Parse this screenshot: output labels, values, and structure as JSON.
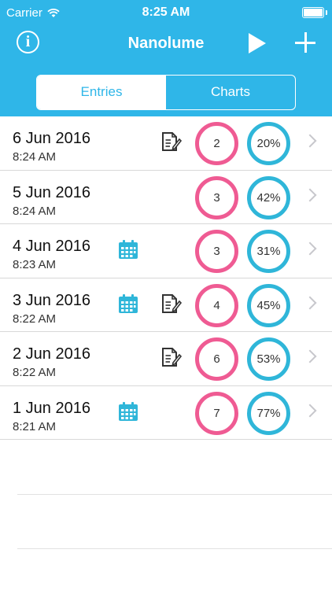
{
  "status": {
    "carrier": "Carrier",
    "time": "8:25 AM"
  },
  "nav": {
    "title": "Nanolume",
    "icons": {
      "info": "info-icon",
      "play": "play-icon",
      "add": "plus-icon"
    }
  },
  "tabs": [
    {
      "label": "Entries",
      "active": true
    },
    {
      "label": "Charts",
      "active": false
    }
  ],
  "entries": [
    {
      "date": "6 Jun 2016",
      "time": "8:24 AM",
      "has_calendar": false,
      "has_note": true,
      "count": "2",
      "percent": "20%"
    },
    {
      "date": "5 Jun 2016",
      "time": "8:24 AM",
      "has_calendar": false,
      "has_note": false,
      "count": "3",
      "percent": "42%"
    },
    {
      "date": "4 Jun 2016",
      "time": "8:23 AM",
      "has_calendar": true,
      "has_note": false,
      "count": "3",
      "percent": "31%"
    },
    {
      "date": "3 Jun 2016",
      "time": "8:22 AM",
      "has_calendar": true,
      "has_note": true,
      "count": "4",
      "percent": "45%"
    },
    {
      "date": "2 Jun 2016",
      "time": "8:22 AM",
      "has_calendar": false,
      "has_note": true,
      "count": "6",
      "percent": "53%"
    },
    {
      "date": "1 Jun 2016",
      "time": "8:21 AM",
      "has_calendar": true,
      "has_note": false,
      "count": "7",
      "percent": "77%"
    }
  ],
  "colors": {
    "accent": "#2fb6e8",
    "count_ring": "#ef5b93",
    "percent_ring": "#2fb6d9"
  }
}
